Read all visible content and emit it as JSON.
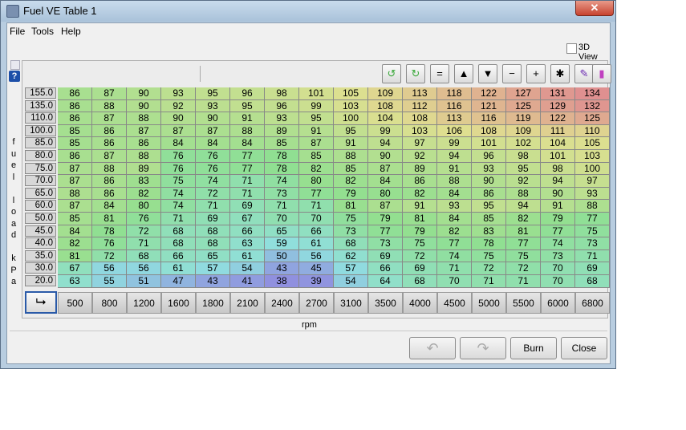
{
  "window": {
    "title": "Fuel VE Table 1",
    "close_label": "✕"
  },
  "menu": [
    "File",
    "Tools",
    "Help"
  ],
  "view3d_label": "3D View",
  "y_axis_label": [
    "f",
    "u",
    "e",
    "l",
    "",
    "l",
    "o",
    "a",
    "d",
    "",
    "k",
    "P",
    "a"
  ],
  "x_axis_label": "rpm",
  "toolbar": {
    "buttons": [
      {
        "name": "rotate-left-icon",
        "glyph": "↺",
        "color": "#3aa83a"
      },
      {
        "name": "rotate-down-icon",
        "glyph": "↻",
        "color": "#3aa83a"
      },
      {
        "name": "equals-button",
        "glyph": "="
      },
      {
        "name": "increase-button",
        "glyph": "▲"
      },
      {
        "name": "decrease-button",
        "glyph": "▼"
      },
      {
        "name": "minus-button",
        "glyph": "−"
      },
      {
        "name": "plus-button",
        "glyph": "+"
      },
      {
        "name": "multiply-button",
        "glyph": "✱"
      },
      {
        "name": "pen-icon",
        "glyph": "✎",
        "color": "#6a2ab0"
      },
      {
        "name": "color-palette-icon",
        "glyph": "▮",
        "color": "#c040c0"
      }
    ]
  },
  "corner_glyph": "⮡",
  "rpm": [
    "500",
    "800",
    "1200",
    "1600",
    "1800",
    "2100",
    "2400",
    "2700",
    "3100",
    "3500",
    "4000",
    "4500",
    "5000",
    "5500",
    "6000",
    "6800"
  ],
  "load": [
    "155.0",
    "135.0",
    "110.0",
    "100.0",
    "85.0",
    "80.0",
    "75.0",
    "70.0",
    "65.0",
    "60.0",
    "50.0",
    "45.0",
    "40.0",
    "35.0",
    "30.0",
    "20.0"
  ],
  "table": [
    [
      86,
      87,
      90,
      93,
      95,
      96,
      98,
      101,
      105,
      109,
      113,
      118,
      122,
      127,
      131,
      134
    ],
    [
      86,
      88,
      90,
      92,
      93,
      95,
      96,
      99,
      103,
      108,
      112,
      116,
      121,
      125,
      129,
      132
    ],
    [
      86,
      87,
      88,
      90,
      90,
      91,
      93,
      95,
      100,
      104,
      108,
      113,
      116,
      119,
      122,
      125
    ],
    [
      85,
      86,
      87,
      87,
      87,
      88,
      89,
      91,
      95,
      99,
      103,
      106,
      108,
      109,
      111,
      110
    ],
    [
      85,
      86,
      86,
      84,
      84,
      84,
      85,
      87,
      91,
      94,
      97,
      99,
      101,
      102,
      104,
      105
    ],
    [
      86,
      87,
      88,
      76,
      76,
      77,
      78,
      85,
      88,
      90,
      92,
      94,
      96,
      98,
      101,
      103
    ],
    [
      87,
      88,
      89,
      76,
      76,
      77,
      78,
      82,
      85,
      87,
      89,
      91,
      93,
      95,
      98,
      100
    ],
    [
      87,
      86,
      83,
      75,
      74,
      71,
      74,
      80,
      82,
      84,
      86,
      88,
      90,
      92,
      94,
      97
    ],
    [
      88,
      86,
      82,
      74,
      72,
      71,
      73,
      77,
      79,
      80,
      82,
      84,
      86,
      88,
      90,
      93
    ],
    [
      87,
      84,
      80,
      74,
      71,
      69,
      71,
      71,
      81,
      87,
      91,
      93,
      95,
      94,
      91,
      88
    ],
    [
      85,
      81,
      76,
      71,
      69,
      67,
      70,
      70,
      75,
      79,
      81,
      84,
      85,
      82,
      79,
      77
    ],
    [
      84,
      78,
      72,
      68,
      68,
      66,
      65,
      66,
      73,
      77,
      79,
      82,
      83,
      81,
      77,
      75
    ],
    [
      82,
      76,
      71,
      68,
      68,
      63,
      59,
      61,
      68,
      73,
      75,
      77,
      78,
      77,
      74,
      73
    ],
    [
      81,
      72,
      68,
      66,
      65,
      61,
      50,
      56,
      62,
      69,
      72,
      74,
      75,
      75,
      73,
      71
    ],
    [
      67,
      56,
      56,
      61,
      57,
      54,
      43,
      45,
      57,
      66,
      69,
      71,
      72,
      72,
      70,
      69
    ],
    [
      63,
      55,
      51,
      47,
      43,
      41,
      38,
      39,
      54,
      64,
      68,
      70,
      71,
      71,
      70,
      68
    ]
  ],
  "buttons": {
    "undo_glyph": "↶",
    "redo_glyph": "↷",
    "burn": "Burn",
    "close": "Close"
  }
}
